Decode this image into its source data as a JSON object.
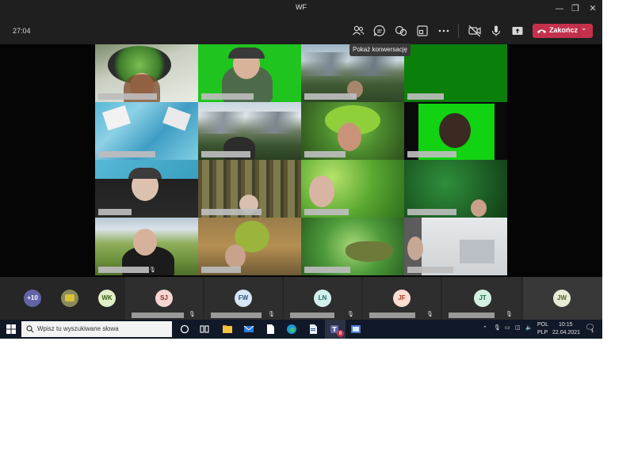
{
  "window": {
    "title": "WF",
    "minimize": "—",
    "restore": "❐",
    "close": "✕"
  },
  "toolbar": {
    "timer": "27:04",
    "leave_label": "Zakończ",
    "tooltip": "Pokaż konwersację"
  },
  "participants_bar": {
    "overflow": "+10",
    "people": [
      {
        "initials": "WK",
        "bg": "#e1efc8",
        "fg": "#3b5d12"
      },
      {
        "initials": "SJ",
        "bg": "#f6d6d3",
        "fg": "#8a2a24"
      },
      {
        "initials": "FW",
        "bg": "#d6e6f6",
        "fg": "#2a4f7a"
      },
      {
        "initials": "LN",
        "bg": "#d2efeb",
        "fg": "#236b63"
      },
      {
        "initials": "JF",
        "bg": "#fbdcd0",
        "fg": "#a43f1c"
      },
      {
        "initials": "JT",
        "bg": "#d3f0e0",
        "fg": "#1f6b42"
      },
      {
        "initials": "JW",
        "bg": "#e6ebd5",
        "fg": "#4e5a2a"
      }
    ]
  },
  "taskbar": {
    "search_placeholder": "Wpisz tu wyszukiwane słowa",
    "lang1": "POL",
    "lang2": "PLP",
    "time": "10:15",
    "date": "22.04.2021",
    "teams_badge": "8",
    "notif_badge": "1"
  },
  "colors": {
    "accent": "#6264a7",
    "leave": "#c4314b"
  }
}
